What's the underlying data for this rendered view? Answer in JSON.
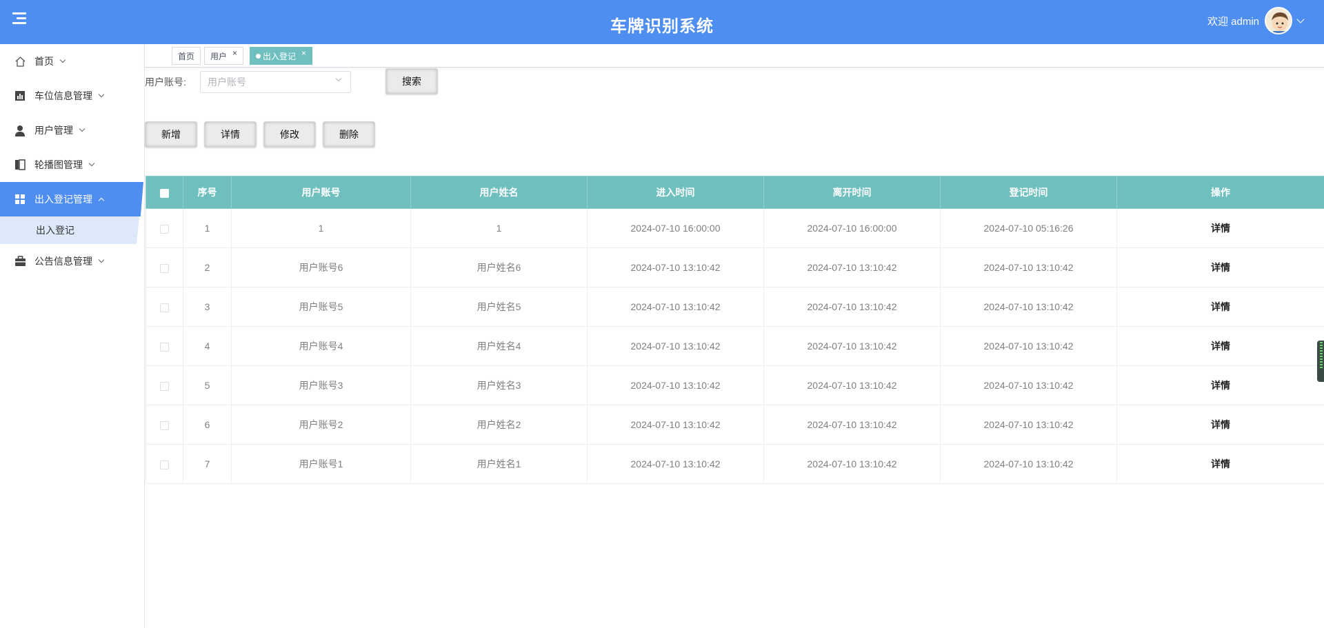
{
  "header": {
    "title": "车牌识别系统",
    "welcome": "欢迎 admin"
  },
  "sidebar": {
    "items": [
      {
        "label": "首页",
        "icon": "home-icon"
      },
      {
        "label": "车位信息管理",
        "icon": "chart-icon"
      },
      {
        "label": "用户管理",
        "icon": "user-icon"
      },
      {
        "label": "轮播图管理",
        "icon": "carousel-icon"
      },
      {
        "label": "出入登记管理",
        "icon": "grid-icon",
        "active": true
      },
      {
        "label": "公告信息管理",
        "icon": "briefcase-icon"
      }
    ],
    "subitem": "出入登记"
  },
  "tabs": [
    {
      "label": "首页"
    },
    {
      "label": "用户"
    },
    {
      "label": "出入登记",
      "active": true
    }
  ],
  "search": {
    "label": "用户账号:",
    "placeholder": "用户账号",
    "button": "搜索"
  },
  "actions": {
    "add": "新增",
    "detail": "详情",
    "edit": "修改",
    "delete": "删除"
  },
  "table": {
    "headers": [
      "序号",
      "用户账号",
      "用户姓名",
      "进入时间",
      "离开时间",
      "登记时间",
      "操作"
    ],
    "rows": [
      {
        "no": "1",
        "account": "1",
        "name": "1",
        "enter": "2024-07-10 16:00:00",
        "leave": "2024-07-10 16:00:00",
        "reg": "2024-07-10 05:16:26",
        "op": "详情"
      },
      {
        "no": "2",
        "account": "用户账号6",
        "name": "用户姓名6",
        "enter": "2024-07-10 13:10:42",
        "leave": "2024-07-10 13:10:42",
        "reg": "2024-07-10 13:10:42",
        "op": "详情"
      },
      {
        "no": "3",
        "account": "用户账号5",
        "name": "用户姓名5",
        "enter": "2024-07-10 13:10:42",
        "leave": "2024-07-10 13:10:42",
        "reg": "2024-07-10 13:10:42",
        "op": "详情"
      },
      {
        "no": "4",
        "account": "用户账号4",
        "name": "用户姓名4",
        "enter": "2024-07-10 13:10:42",
        "leave": "2024-07-10 13:10:42",
        "reg": "2024-07-10 13:10:42",
        "op": "详情"
      },
      {
        "no": "5",
        "account": "用户账号3",
        "name": "用户姓名3",
        "enter": "2024-07-10 13:10:42",
        "leave": "2024-07-10 13:10:42",
        "reg": "2024-07-10 13:10:42",
        "op": "详情"
      },
      {
        "no": "6",
        "account": "用户账号2",
        "name": "用户姓名2",
        "enter": "2024-07-10 13:10:42",
        "leave": "2024-07-10 13:10:42",
        "reg": "2024-07-10 13:10:42",
        "op": "详情"
      },
      {
        "no": "7",
        "account": "用户账号1",
        "name": "用户姓名1",
        "enter": "2024-07-10 13:10:42",
        "leave": "2024-07-10 13:10:42",
        "reg": "2024-07-10 13:10:42",
        "op": "详情"
      }
    ]
  },
  "colors": {
    "primary": "#4d8ef0",
    "table_header": "#6fbfbf",
    "submenu_bg": "#dde9fb"
  }
}
